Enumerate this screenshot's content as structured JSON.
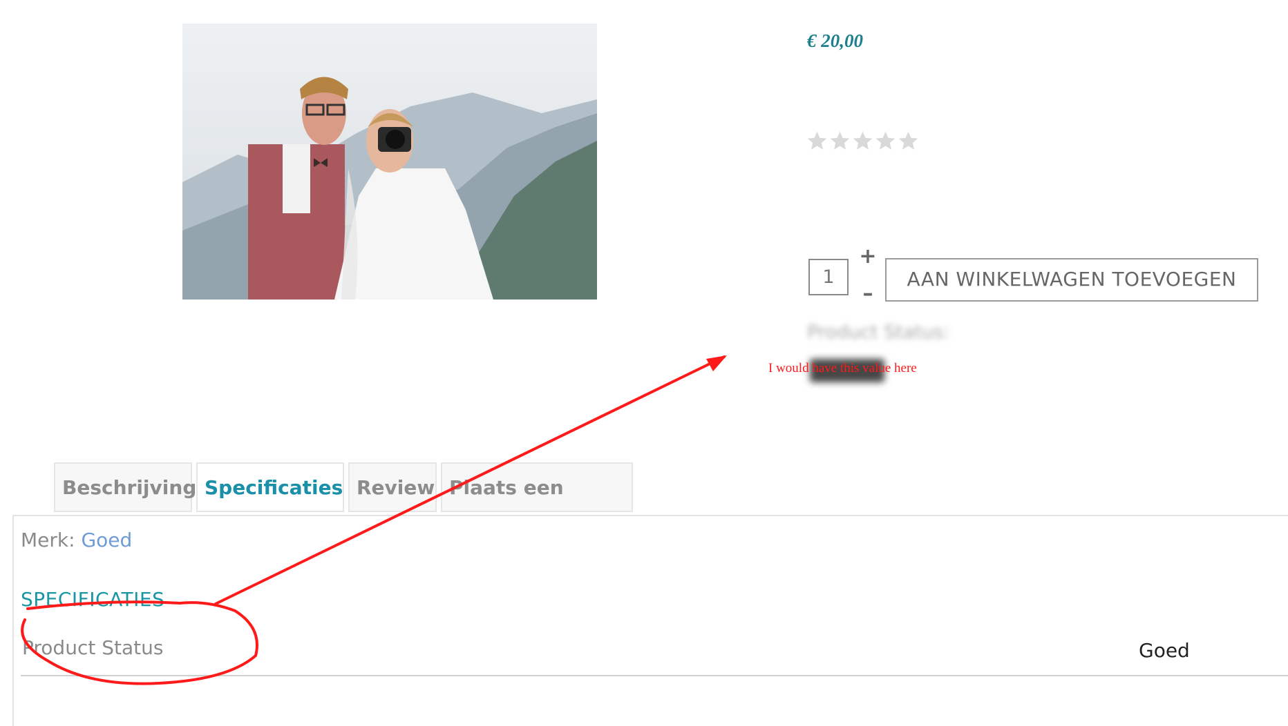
{
  "product": {
    "price": "€ 20,00",
    "rating": 0,
    "rating_max": 5,
    "quantity": "1",
    "qty_plus": "+",
    "qty_minus": "–",
    "add_to_cart_label": "AAN WINKELWAGEN TOEVOEGEN",
    "blurred_status_label": "Product Status:"
  },
  "annotation": {
    "text": "I would have this value here",
    "color": "#ff1a1a"
  },
  "tabs": [
    {
      "label": "Beschrijving",
      "active": false
    },
    {
      "label": "Specificaties",
      "active": true
    },
    {
      "label": "Review",
      "active": false
    },
    {
      "label": "Plaats een review",
      "active": false
    }
  ],
  "specs": {
    "merk_label": "Merk:",
    "merk_value": "Goed",
    "heading": "SPECIFICATIES",
    "rows": [
      {
        "label": "Product Status",
        "value": "Goed"
      }
    ]
  },
  "colors": {
    "accent": "#1a8fa8",
    "price": "#1b7f8e",
    "link": "#6e9cd6"
  }
}
